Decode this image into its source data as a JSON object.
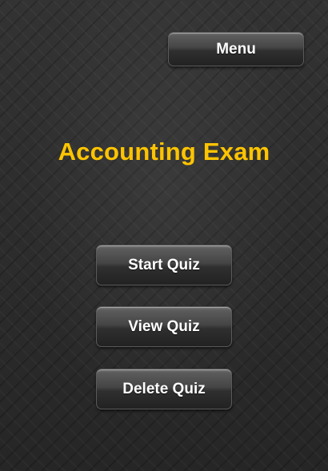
{
  "header": {
    "menu_label": "Menu"
  },
  "main": {
    "title": "Accounting Exam",
    "title_color": "#ffc400",
    "buttons": [
      {
        "label": "Start Quiz"
      },
      {
        "label": "View Quiz"
      },
      {
        "label": "Delete Quiz"
      }
    ]
  }
}
